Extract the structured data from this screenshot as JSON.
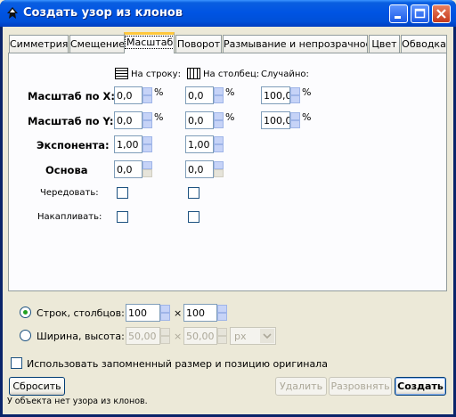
{
  "window": {
    "title": "Создать узор из клонов"
  },
  "tabs": [
    {
      "label": "Симметрия"
    },
    {
      "label": "Смещение"
    },
    {
      "label": "Масштаб"
    },
    {
      "label": "Поворот"
    },
    {
      "label": "Размывание и непрозрачность"
    },
    {
      "label": "Цвет"
    },
    {
      "label": "Обводка"
    }
  ],
  "scale": {
    "col_headers": {
      "per_row": "На строку:",
      "per_column": "На столбец:",
      "random": "Случайно:"
    },
    "rows": {
      "scale_x": {
        "label": "Масштаб по X:",
        "per_row": "0,0",
        "per_column": "0,0",
        "random": "100,0",
        "unit": "%"
      },
      "scale_y": {
        "label": "Масштаб по Y:",
        "per_row": "0,0",
        "per_column": "0,0",
        "random": "100,0",
        "unit": "%"
      },
      "exponent": {
        "label": "Экспонента:",
        "per_row": "1,00",
        "per_column": "1,00"
      },
      "base": {
        "label": "Основа",
        "per_row": "0,0",
        "per_column": "0,0"
      },
      "alternate": {
        "label": "Чередовать:"
      },
      "cumulate": {
        "label": "Накапливать:"
      }
    }
  },
  "layout_mode": {
    "rows_cols": {
      "label": "Строк, столбцов:",
      "rows": "100",
      "cols": "100",
      "selected": true
    },
    "width_height": {
      "label": "Ширина, высота:",
      "width": "50,00",
      "height": "50,00",
      "unit": "px",
      "selected": false
    },
    "times": "×"
  },
  "use_saved": {
    "label": "Использовать запомненный размер и позицию оригинала"
  },
  "buttons": {
    "reset": "Сбросить",
    "delete": "Удалить",
    "unclump": "Разровнять",
    "create": "Создать"
  },
  "status": "У объекта нет узора из клонов."
}
